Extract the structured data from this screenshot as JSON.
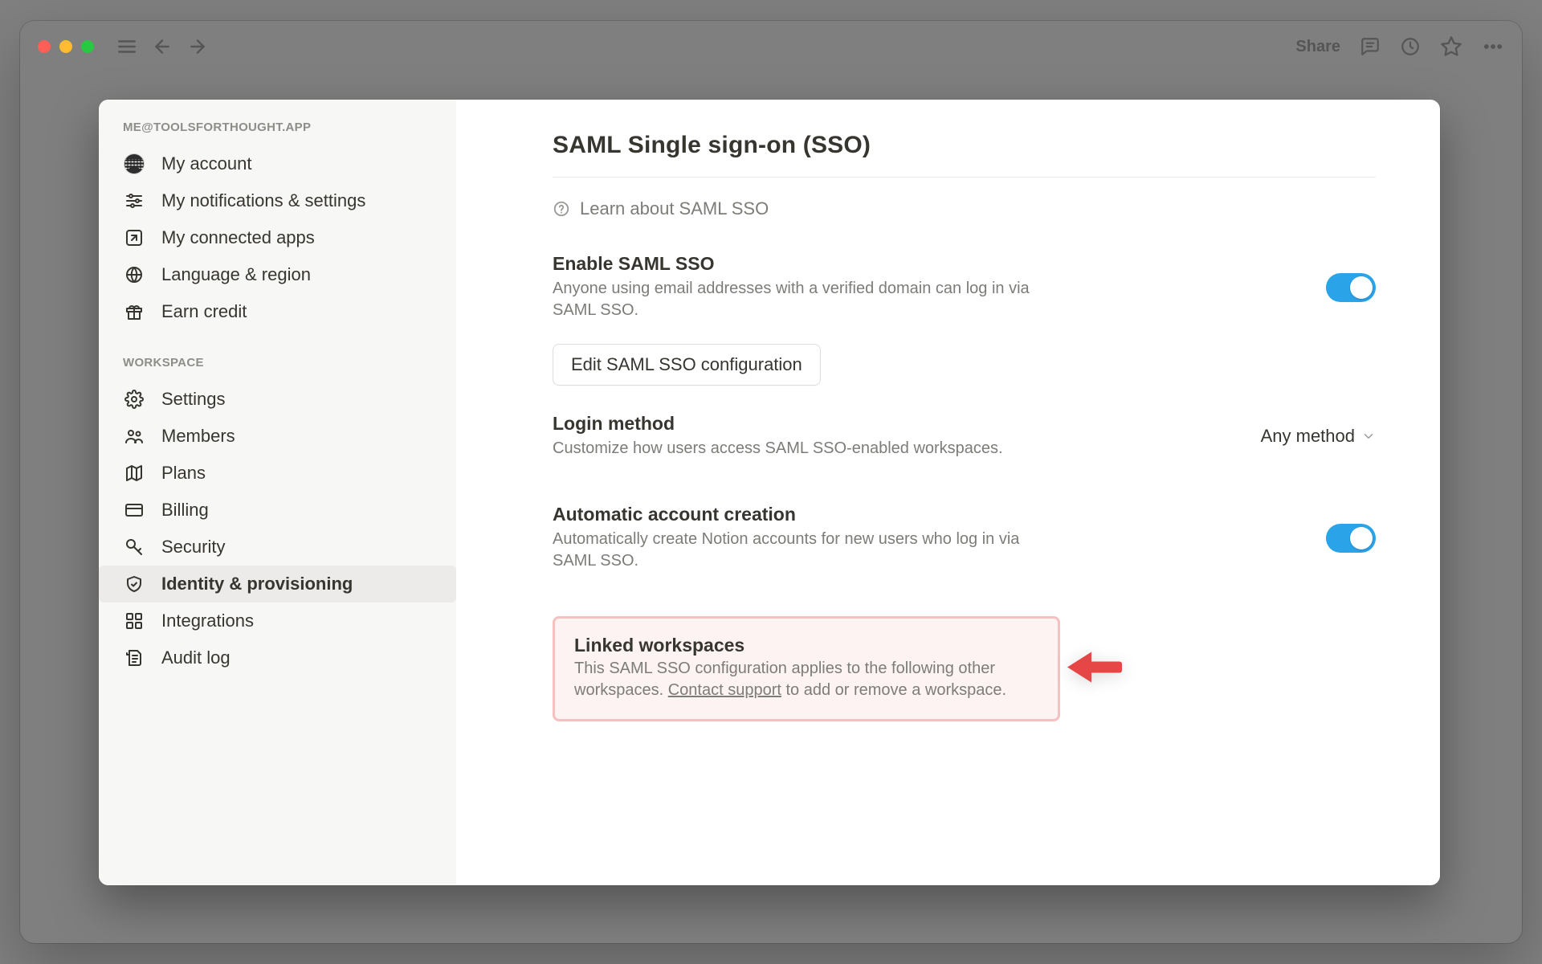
{
  "titlebar": {
    "share_label": "Share"
  },
  "sidebar": {
    "account_header": "ME@TOOLSFORTHOUGHT.APP",
    "workspace_header": "WORKSPACE",
    "items_account": [
      {
        "label": "My account"
      },
      {
        "label": "My notifications & settings"
      },
      {
        "label": "My connected apps"
      },
      {
        "label": "Language & region"
      },
      {
        "label": "Earn credit"
      }
    ],
    "items_workspace": [
      {
        "label": "Settings"
      },
      {
        "label": "Members"
      },
      {
        "label": "Plans"
      },
      {
        "label": "Billing"
      },
      {
        "label": "Security"
      },
      {
        "label": "Identity & provisioning"
      },
      {
        "label": "Integrations"
      },
      {
        "label": "Audit log"
      }
    ]
  },
  "page": {
    "title": "SAML Single sign-on (SSO)",
    "learn_label": "Learn about SAML SSO",
    "enable": {
      "title": "Enable SAML SSO",
      "desc": "Anyone using email addresses with a verified domain can log in via SAML SSO.",
      "button": "Edit SAML SSO configuration"
    },
    "login": {
      "title": "Login method",
      "desc": "Customize how users access SAML SSO-enabled workspaces.",
      "value": "Any method"
    },
    "auto": {
      "title": "Automatic account creation",
      "desc": "Automatically create Notion accounts for new users who log in via SAML SSO."
    },
    "linked": {
      "title": "Linked workspaces",
      "desc_a": "This SAML SSO configuration applies to the following other workspaces. ",
      "link": "Contact support",
      "desc_b": " to add or remove a workspace."
    }
  }
}
